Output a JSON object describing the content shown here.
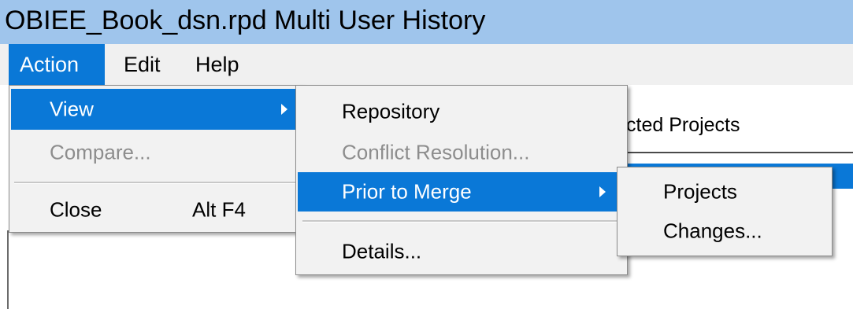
{
  "window": {
    "title": "OBIEE_Book_dsn.rpd Multi User History"
  },
  "menubar": {
    "items": [
      {
        "label": "Action",
        "active": true
      },
      {
        "label": "Edit"
      },
      {
        "label": "Help"
      }
    ]
  },
  "background": {
    "partial_tab_text": "cted Projects"
  },
  "action_menu": {
    "view": "View",
    "compare": "Compare...",
    "close": "Close",
    "close_shortcut": "Alt F4"
  },
  "view_submenu": {
    "repository": "Repository",
    "conflict_resolution": "Conflict Resolution...",
    "prior_to_merge": "Prior to Merge",
    "details": "Details..."
  },
  "prior_to_merge_submenu": {
    "projects": "Projects",
    "changes": "Changes..."
  },
  "icons": {
    "submenu_arrow": "chevron-right-icon"
  },
  "colors": {
    "titlebar": "#9fc5ec",
    "highlight": "#0a78d7",
    "menu_bg": "#f2f2f2",
    "disabled_text": "#8d8d8d"
  }
}
